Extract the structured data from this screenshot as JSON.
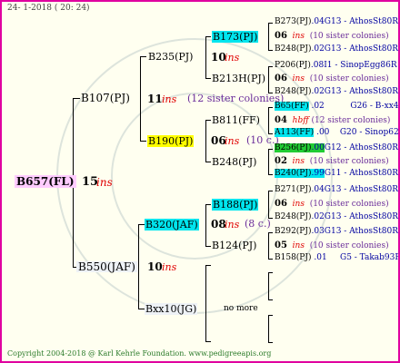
{
  "header": "24-  1-2018 ( 20: 24)",
  "footer": "Copyright 2004-2018 @ Karl Kehrle Foundation.   www.pedigreeapis.org",
  "colors": {
    "frame": "#e000a0",
    "bg": "#fffff0",
    "ins": "#e00000",
    "sisters": "#6a2c9a",
    "links": "#0000a0",
    "cyan": "#00e5ee",
    "yellow": "#ffff00",
    "green": "#22cc33",
    "pink": "#ffccff"
  },
  "gen1": {
    "id": "B657(FL)",
    "year": "15",
    "ins": "ins"
  },
  "gen2": [
    {
      "id": "B107(PJ)",
      "year": "11",
      "ins": "ins",
      "sisters": "(12 sister colonies)"
    },
    {
      "id": "B550(JAF)",
      "year": "10",
      "ins": "ins"
    }
  ],
  "gen3": [
    {
      "id": "B235(PJ)",
      "year": "10",
      "ins": "ins"
    },
    {
      "id": "B190(PJ)",
      "year": "06",
      "ins": "ins",
      "sisters": "(10 c.)"
    },
    {
      "id": "B320(JAF)",
      "year": "08",
      "ins": "ins",
      "sisters": "(8 c.)"
    },
    {
      "id": "Bxx10(JG)",
      "no_more": "no more"
    }
  ],
  "gen4": [
    {
      "id": "B173(PJ)",
      "year": "10",
      "ins": "ins"
    },
    {
      "id": "B213H(PJ)"
    },
    {
      "id": "B811(FF)"
    },
    {
      "id": "B248(PJ)"
    },
    {
      "id": "B188(PJ)"
    },
    {
      "id": "B124(PJ)"
    }
  ],
  "gen5": [
    {
      "id": "B273(PJ)",
      "suffix": ".04G13 - AthosSt80R"
    },
    {
      "year": "06",
      "ins": "ins",
      "sisters": "(10 sister colonies)"
    },
    {
      "id": "B248(PJ)",
      "suffix": ".02G13 - AthosSt80R"
    },
    {
      "id": "P206(PJ)",
      "suffix": ".08I1 - SinopEgg86R"
    },
    {
      "year": "06",
      "ins": "ins",
      "sisters": "(10 sister colonies)"
    },
    {
      "id": "B248(PJ)",
      "suffix": ".02G13 - AthosSt80R"
    },
    {
      "id": "B65(FF)",
      "mid": ".02",
      "suffix": "G26 - B-xx43"
    },
    {
      "year": "04",
      "ins": "hbff",
      "sisters": "(12 sister colonies)"
    },
    {
      "id": "A113(FF)",
      "mid": ".00",
      "suffix": "G20 - Sinop62R"
    },
    {
      "id": "B256(PJ)",
      "mid": ".00",
      "suffix": "G12 - AthosSt80R"
    },
    {
      "year": "02",
      "ins": "ins",
      "sisters": "(10 sister colonies)"
    },
    {
      "id": "B240(PJ)",
      "mid": ".99",
      "suffix": "G11 - AthosSt80R"
    },
    {
      "id": "B271(PJ)",
      "suffix": ".04G13 - AthosSt80R"
    },
    {
      "year": "06",
      "ins": "ins",
      "sisters": "(10 sister colonies)"
    },
    {
      "id": "B248(PJ)",
      "suffix": ".02G13 - AthosSt80R"
    },
    {
      "id": "B292(PJ)",
      "suffix": ".03G13 - AthosSt80R"
    },
    {
      "year": "05",
      "ins": "ins",
      "sisters": "(10 sister colonies)"
    },
    {
      "id": "B158(PJ)",
      "mid": ".01",
      "suffix": "G5 - Takab93R"
    }
  ]
}
